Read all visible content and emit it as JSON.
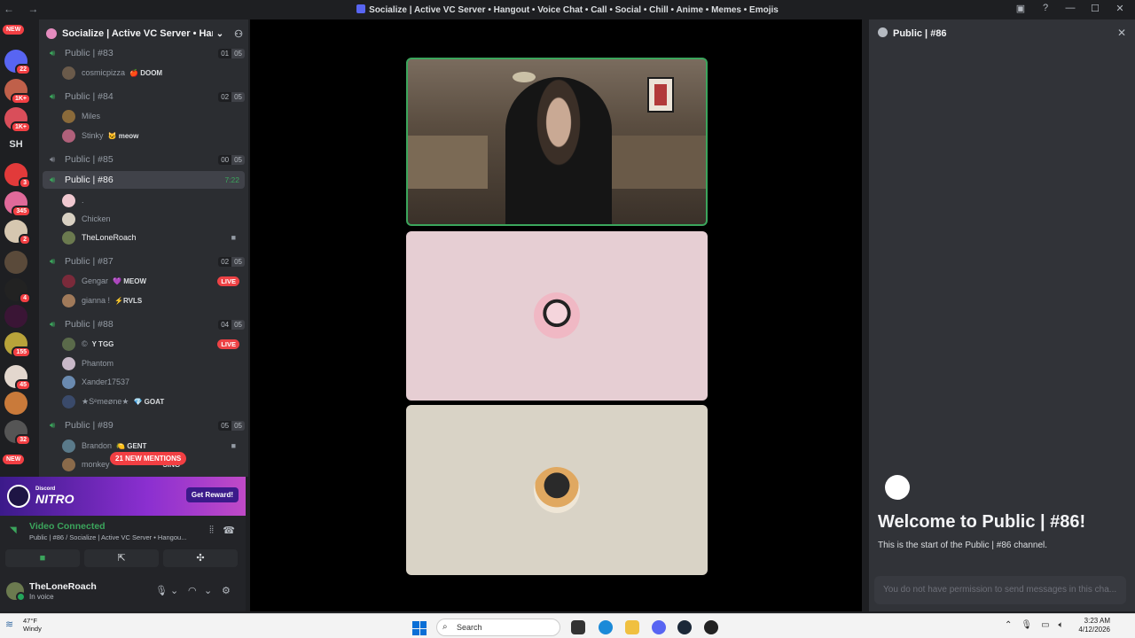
{
  "window": {
    "title": "Socialize | Active VC Server • Hangout • Voice Chat • Call • Social • Chill • Anime • Memes • Emojis"
  },
  "guilds": {
    "top_badge": "NEW",
    "badges": [
      "22",
      "1K+",
      "1K+",
      "3",
      "345",
      "2",
      "4",
      "155",
      "45",
      "32"
    ],
    "initials": "SH",
    "bottom_badge": "NEW"
  },
  "server": {
    "name": "Socialize | Active VC Server • Han..."
  },
  "channels": [
    {
      "label": "Public | #83",
      "count_a": "01",
      "count_b": "05",
      "members": [
        {
          "name": "cosmicpizza",
          "tag": "🍎 DOOM"
        }
      ]
    },
    {
      "label": "Public | #84",
      "count_a": "02",
      "count_b": "05",
      "members": [
        {
          "name": "Miles",
          "tag": ""
        },
        {
          "name": "Stinky",
          "tag": "🐱 meow"
        }
      ]
    },
    {
      "label": "Public | #85",
      "count_a": "00",
      "count_b": "05",
      "members": []
    },
    {
      "label": "Public | #86",
      "timer": "7:22",
      "members": [
        {
          "name": ".",
          "tag": ""
        },
        {
          "name": "Chicken",
          "tag": ""
        },
        {
          "name": "TheLoneRoach",
          "tag": ""
        }
      ]
    },
    {
      "label": "Public | #87",
      "count_a": "02",
      "count_b": "05",
      "members": [
        {
          "name": "Gengar",
          "tag": "💜 MEOW",
          "live": "LIVE"
        },
        {
          "name": "gianna !",
          "tag": "⚡RVLS"
        }
      ]
    },
    {
      "label": "Public | #88",
      "count_a": "04",
      "count_b": "05",
      "members": [
        {
          "name": "©",
          "tag": "Y TGG",
          "live": "LIVE"
        },
        {
          "name": "Phantom",
          "tag": ""
        },
        {
          "name": "Xander17537",
          "tag": ""
        },
        {
          "name": "★Sᵉmeøne★",
          "tag": "💎 GOAT"
        }
      ]
    },
    {
      "label": "Public | #89",
      "count_a": "05",
      "count_b": "05",
      "members": [
        {
          "name": "Brandon",
          "tag": "🍋 GENT"
        },
        {
          "name": "monkey",
          "tag": "SING"
        }
      ]
    }
  ],
  "mentions": "21 NEW MENTIONS",
  "nitro": {
    "small": "Discord",
    "brand": "NITRO",
    "button": "Get Reward!"
  },
  "voice": {
    "status": "Video Connected",
    "detail": "Public | #86 / Socialize | Active VC Server • Hangou..."
  },
  "user": {
    "name": "TheLoneRoach",
    "status": "In voice"
  },
  "panel": {
    "channel": "Public | #86",
    "welcome": "Welcome to Public | #86!",
    "subtitle": "This is the start of the Public | #86 channel.",
    "input_placeholder": "You do not have permission to send messages in this cha..."
  },
  "taskbar": {
    "temp": "47°F",
    "weather": "Windy",
    "search": "Search",
    "time": "3:23 AM",
    "date": "4/12/2026"
  },
  "colors": {
    "accent_green": "#3ba55c",
    "alert_red": "#f23f43",
    "brand": "#5865f2"
  }
}
